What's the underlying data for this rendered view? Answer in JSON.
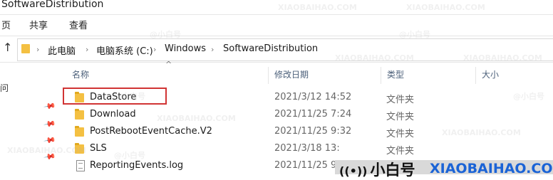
{
  "window": {
    "title": "SoftwareDistribution"
  },
  "ribbon": {
    "tabs": [
      "页",
      "共享",
      "查看"
    ]
  },
  "address": {
    "crumbs": [
      "此电脑",
      "电脑系统 (C:)",
      "Windows",
      "SoftwareDistribution"
    ]
  },
  "left_pane": {
    "label": "问"
  },
  "columns": {
    "name": "名称",
    "date": "修改日期",
    "type": "类型",
    "size": "大小"
  },
  "files": [
    {
      "name": "DataStore",
      "date": "2021/3/12 14:52",
      "type": "文件夹",
      "kind": "folder",
      "highlighted": true
    },
    {
      "name": "Download",
      "date": "2021/11/25 7:24",
      "type": "文件夹",
      "kind": "folder"
    },
    {
      "name": "PostRebootEventCache.V2",
      "date": "2021/11/25 9:32",
      "type": "文件夹",
      "kind": "folder"
    },
    {
      "name": "SLS",
      "date": "2021/3/18 13:",
      "type": "文件夹",
      "kind": "folder"
    },
    {
      "name": "ReportingEvents.log",
      "date": "2021/11/25 9:",
      "type": "",
      "kind": "file"
    }
  ],
  "watermark": {
    "text": "XIAOBAIHAO.COM",
    "secondary": "@小白号"
  },
  "branding": {
    "name": "小白号",
    "site": "XIAOBAIHAO.COM"
  },
  "colors": {
    "highlight": "#d13434",
    "folder": "#f4c042",
    "brand_site": "#1a63d6"
  }
}
